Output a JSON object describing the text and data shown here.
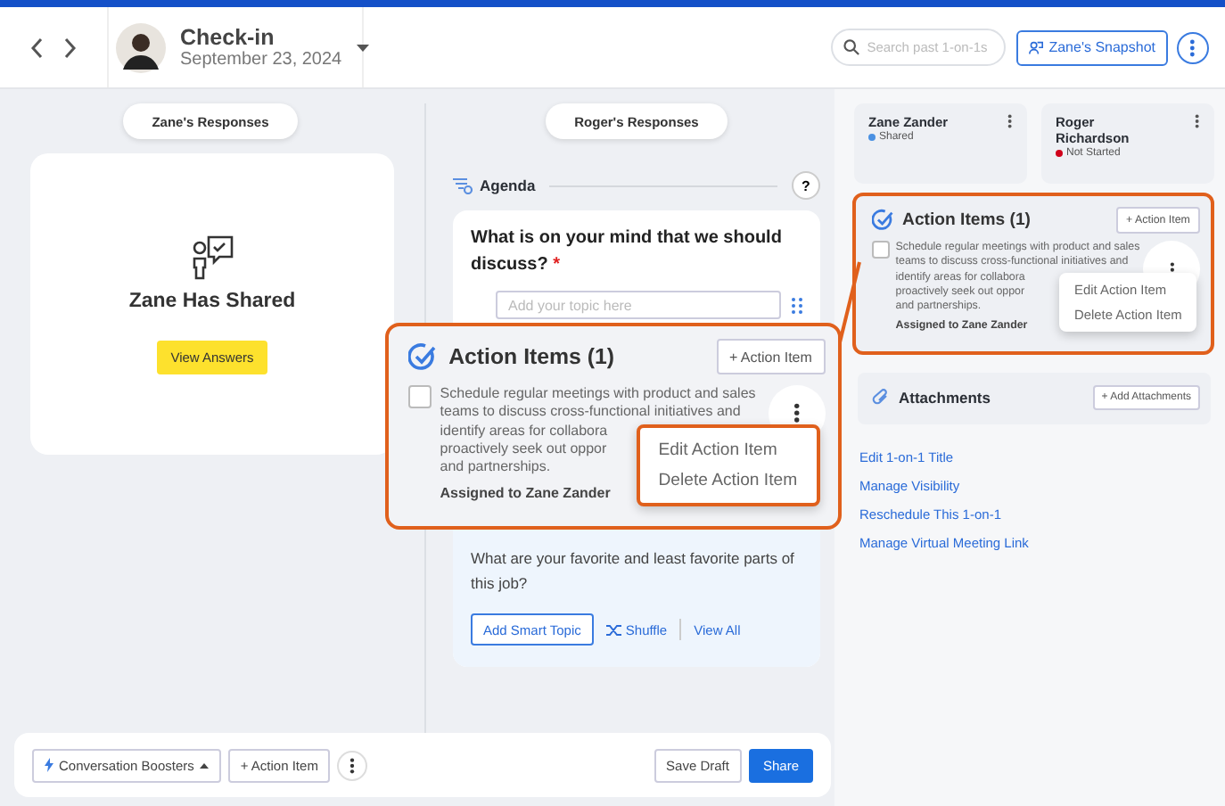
{
  "header": {
    "title": "Check-in",
    "date": "September 23, 2024",
    "search": {
      "placeholder": "Search past 1-on-1s"
    },
    "snapshot_button": "Zane's Snapshot"
  },
  "left_panel": {
    "tab": "Zane's Responses",
    "status_title": "Zane Has Shared",
    "view_button": "View Answers"
  },
  "middle_panel": {
    "tab": "Roger's Responses",
    "agenda": {
      "title": "Agenda",
      "help": "?"
    },
    "topic": {
      "question": "What is on your mind that we should discuss?",
      "required_mark": "*",
      "input": {
        "placeholder": "Add your topic here"
      }
    },
    "suggestion": {
      "question": "What are your favorite and least favorite parts of this job?",
      "add_button": "Add Smart Topic",
      "shuffle": "Shuffle",
      "view_all": "View All"
    }
  },
  "participants": [
    {
      "name": "Zane Zander",
      "status": "Shared",
      "color": "#4a90e2"
    },
    {
      "name": "Roger Richardson",
      "status": "Not Started",
      "color": "#d0021b"
    }
  ],
  "action_items": {
    "title": "Action Items (1)",
    "add_button": "+ Action Item",
    "items": [
      {
        "checked": false,
        "lines": [
          "Schedule regular meetings with product and sales",
          "teams to discuss cross-functional initiatives and",
          "identify areas for collabora",
          "proactively seek out oppor",
          "and partnerships."
        ],
        "assigned": "Assigned to Zane Zander"
      }
    ],
    "menu": [
      "Edit Action Item",
      "Delete Action Item"
    ]
  },
  "zoom_callout": {
    "title": "Action Items (1)",
    "add_button": "+ Action Item",
    "items": [
      {
        "checked": false,
        "lines": [
          "Schedule regular meetings with product and sales",
          "teams to discuss cross-functional initiatives and",
          "identify areas for collabora",
          "proactively seek out oppor",
          "and partnerships."
        ],
        "assigned": "Assigned to Zane Zander"
      }
    ],
    "menu": [
      "Edit Action Item",
      "Delete Action Item"
    ]
  },
  "attachments": {
    "title": "Attachments",
    "add_button": "+ Add Attachments"
  },
  "links": [
    "Edit 1-on-1 Title",
    "Manage Visibility",
    "Reschedule This 1-on-1",
    "Manage Virtual Meeting Link"
  ],
  "footer": {
    "boosters": "Conversation Boosters",
    "action_button": "+ Action Item",
    "save": "Save Draft",
    "share": "Share"
  }
}
